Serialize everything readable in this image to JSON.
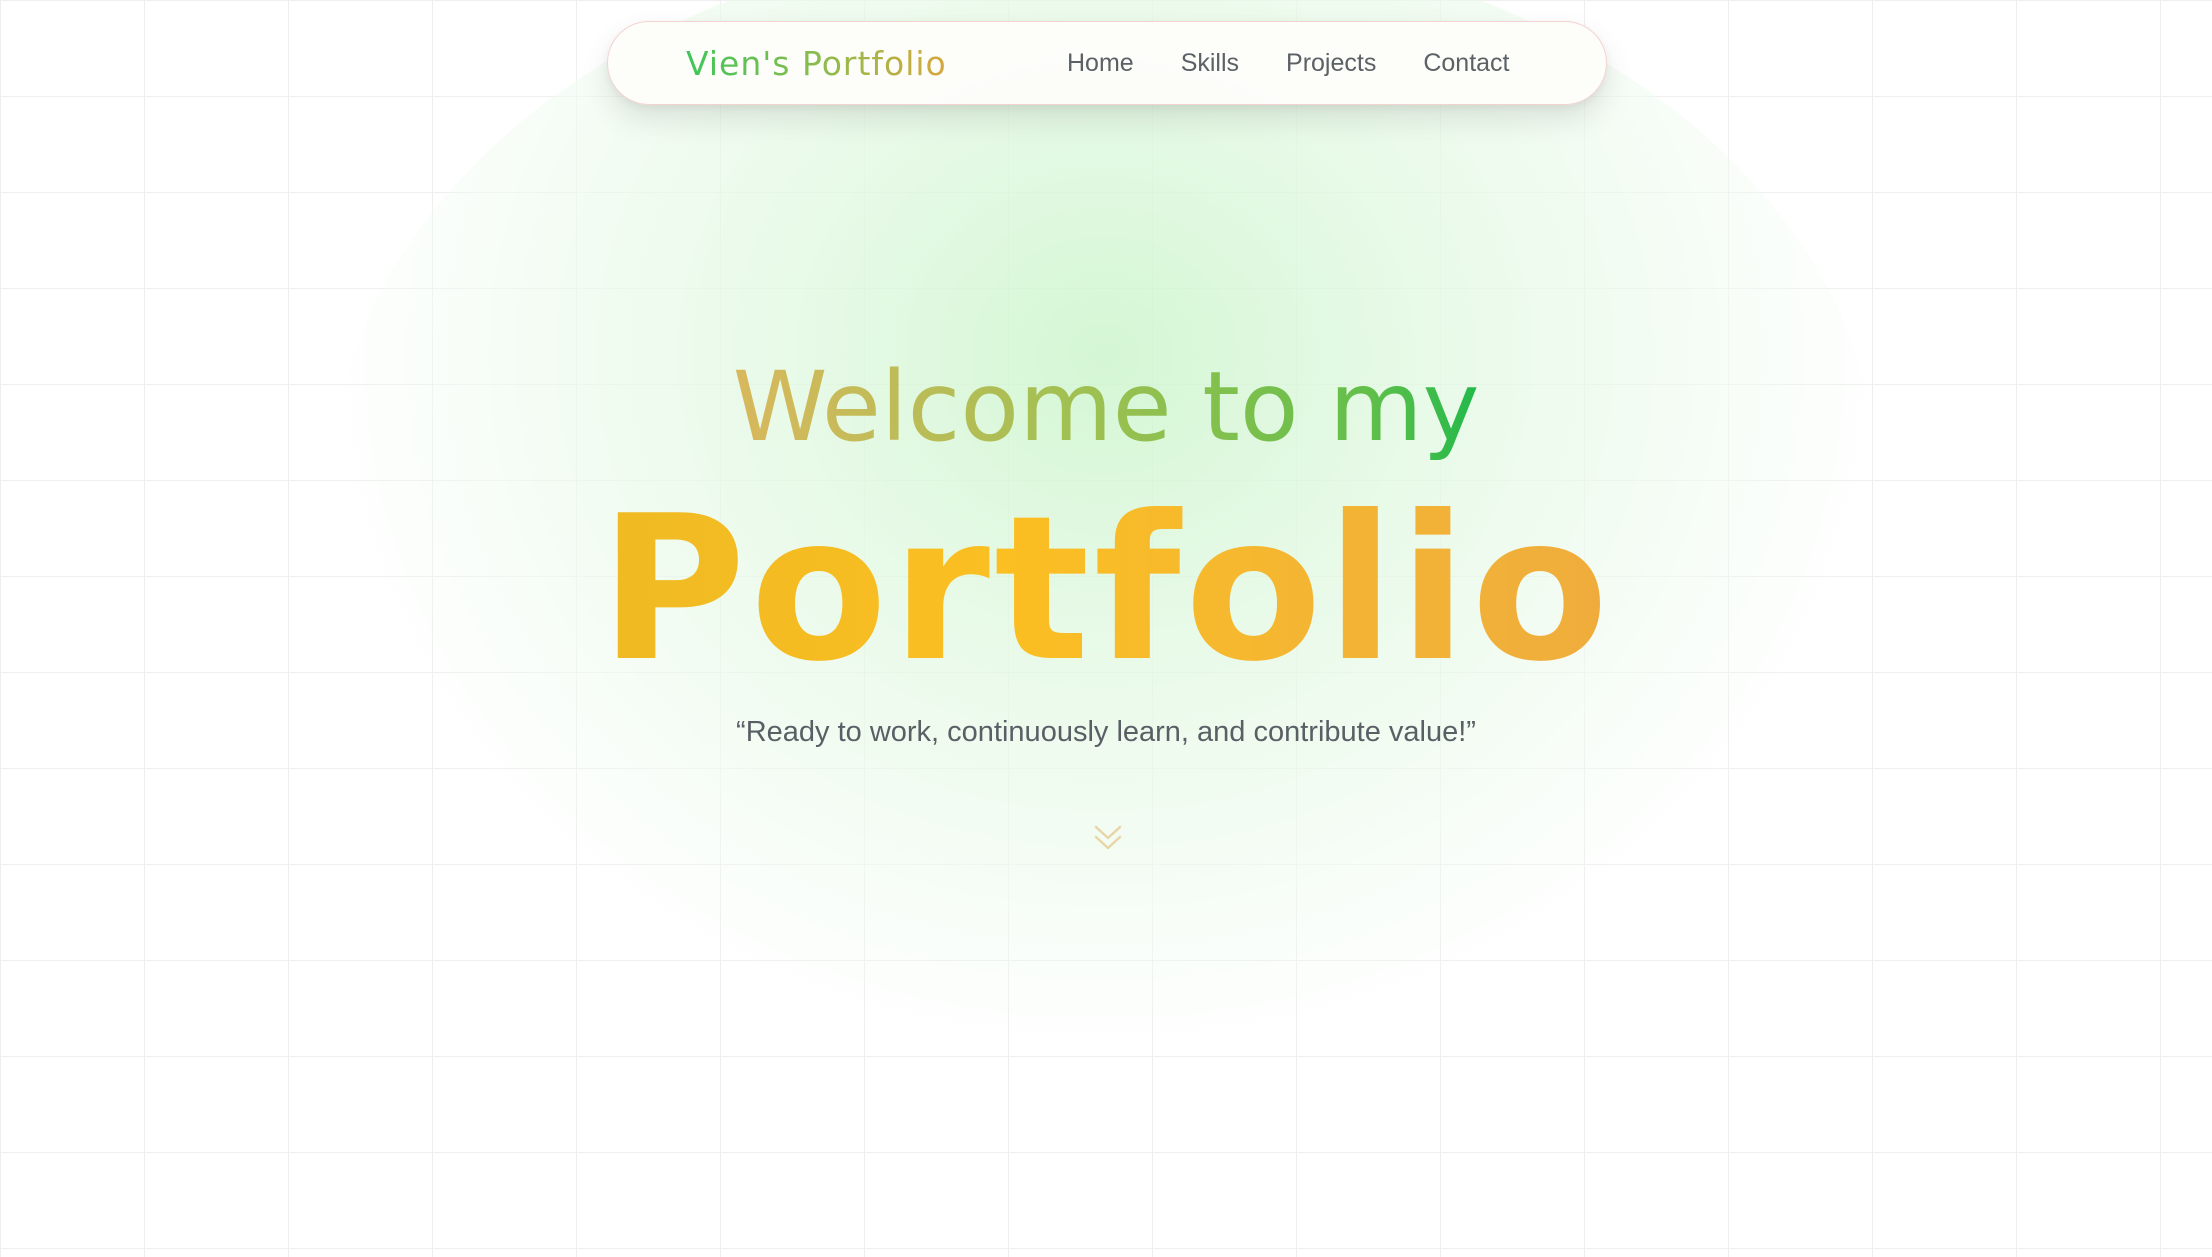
{
  "navbar": {
    "logo": "Vien's Portfolio",
    "links": [
      "Home",
      "Skills",
      "Projects",
      "Contact"
    ]
  },
  "hero": {
    "welcome": "Welcome to my",
    "title": "Portfolio",
    "tagline": "“Ready to work, continuously learn, and contribute value!”",
    "scroll_icon": "double-chevron-down-icon"
  },
  "colors": {
    "logo_gradient": [
      "#3fc659",
      "#98b94c",
      "#f1a038"
    ],
    "welcome_gradient": [
      "#d9b85d",
      "#a2c052",
      "#22b94a"
    ],
    "title_gradient": [
      "#efba23",
      "#fbbf22",
      "#efac3c"
    ],
    "nav_text": "#5c6166",
    "nav_border": "#f3d3cf",
    "tagline_text": "#5a5f66",
    "background_glow": "#cdf5cd"
  }
}
